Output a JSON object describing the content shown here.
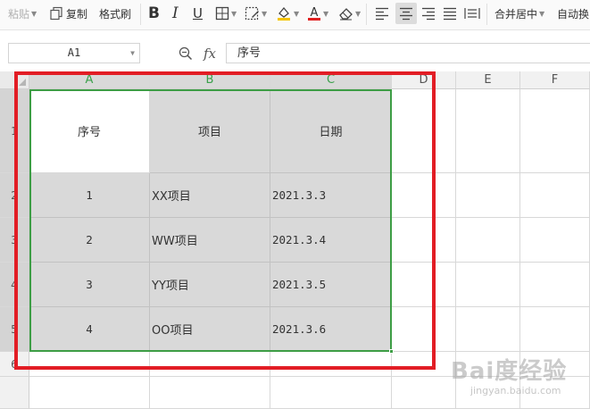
{
  "ribbon": {
    "paste": "粘贴",
    "copy": "复制",
    "format_painter": "格式刷",
    "merge_center": "合并居中",
    "auto_wrap": "自动换"
  },
  "formula_bar": {
    "cell_ref": "A1",
    "fx": "fx",
    "formula_value": "序号"
  },
  "columns": [
    "A",
    "B",
    "C",
    "D",
    "E",
    "F"
  ],
  "rows": [
    "1",
    "2",
    "3",
    "4",
    "5",
    "6"
  ],
  "table": {
    "headers": [
      "序号",
      "项目",
      "日期"
    ],
    "rows": [
      [
        "1",
        "XX项目",
        "2021.3.3"
      ],
      [
        "2",
        "WW项目",
        "2021.3.4"
      ],
      [
        "3",
        "YY项目",
        "2021.3.5"
      ],
      [
        "4",
        "OO项目",
        "2021.3.6"
      ]
    ]
  },
  "watermark": {
    "main": "Bai度经验",
    "sub": "jingyan.baidu.com"
  },
  "colors": {
    "selection_green": "#3d9d45",
    "highlight_red": "#e21d25",
    "cell_gray": "#d9d9d9",
    "font_color_red": "#e02020",
    "fill_color_yellow": "#f5c400"
  }
}
